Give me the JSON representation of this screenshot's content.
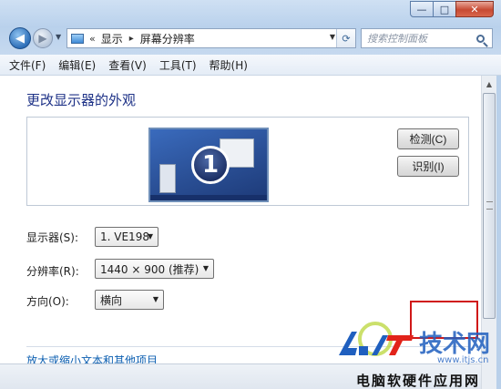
{
  "window": {
    "caption": {
      "minimize": "—",
      "maximize": "□",
      "close": "✕"
    }
  },
  "nav": {
    "back_icon": "arrow-left-icon",
    "forward_icon": "arrow-right-icon",
    "breadcrumb_prefix": "«",
    "breadcrumb": [
      "显示",
      "屏幕分辨率"
    ],
    "breadcrumb_arrow": "▸",
    "search_placeholder": "搜索控制面板"
  },
  "menubar": {
    "items": [
      "文件(F)",
      "编辑(E)",
      "查看(V)",
      "工具(T)",
      "帮助(H)"
    ]
  },
  "main": {
    "title": "更改显示器的外观",
    "monitor_number": "1",
    "detect_button": "检测(C)",
    "identify_button": "识别(I)",
    "display_label": "显示器(S):",
    "display_value": "1. VE198",
    "resolution_label": "分辨率(R):",
    "resolution_value": "1440 × 900 (推荐)",
    "orientation_label": "方向(O):",
    "orientation_value": "横向",
    "link_text": "放大或缩小文本和其他项目"
  },
  "watermark": {
    "logo_text": "技术网",
    "site_text": "www.itjs.cn",
    "name": "电脑软硬件应用网"
  },
  "colors": {
    "title_blue": "#1e3287",
    "link_blue": "#0c5fb1",
    "highlight_red": "#d01818"
  }
}
